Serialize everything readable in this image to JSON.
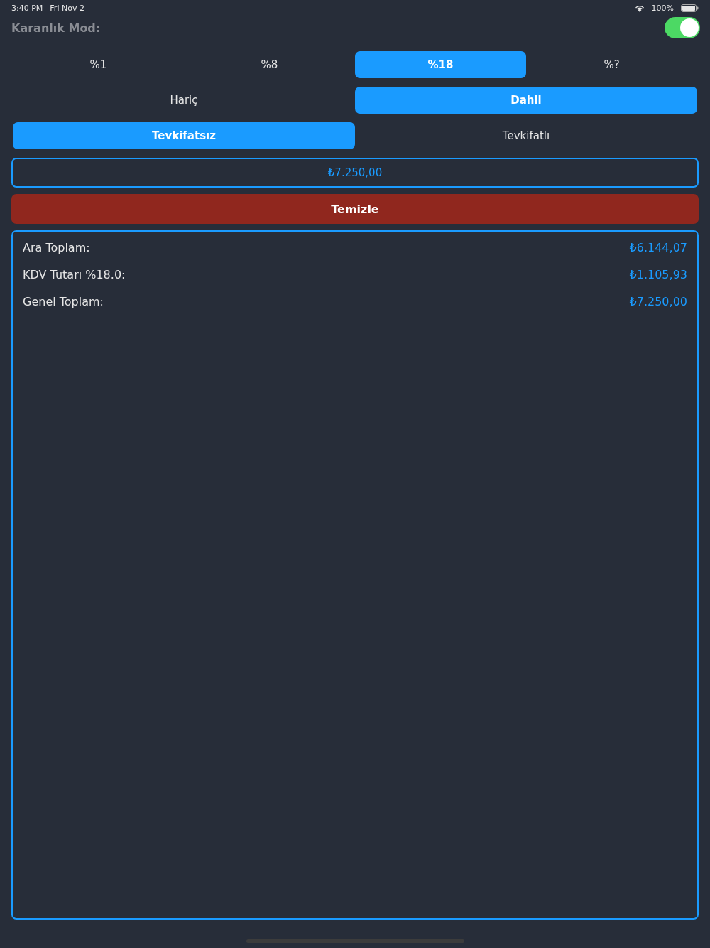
{
  "status_bar": {
    "time": "3:40 PM",
    "date": "Fri Nov 2",
    "battery": "100%"
  },
  "dark_mode": {
    "label": "Karanlık Mod:",
    "on": true
  },
  "segments": [
    {
      "options": [
        {
          "label": "%1",
          "selected": false
        },
        {
          "label": "%8",
          "selected": false
        },
        {
          "label": "%18",
          "selected": true
        },
        {
          "label": "%?",
          "selected": false
        }
      ]
    },
    {
      "options": [
        {
          "label": "Hariç",
          "selected": false
        },
        {
          "label": "Dahil",
          "selected": true
        }
      ]
    },
    {
      "options": [
        {
          "label": "Tevkifatsız",
          "selected": true
        },
        {
          "label": "Tevkifatlı",
          "selected": false
        }
      ]
    }
  ],
  "amount_field": {
    "value": "₺7.250,00"
  },
  "clear_button": {
    "label": "Temizle"
  },
  "results": [
    {
      "label": "Ara Toplam:",
      "value": "₺6.144,07"
    },
    {
      "label": "KDV Tutarı %18.0:",
      "value": "₺1.105,93"
    },
    {
      "label": "Genel Toplam:",
      "value": "₺7.250,00"
    }
  ]
}
